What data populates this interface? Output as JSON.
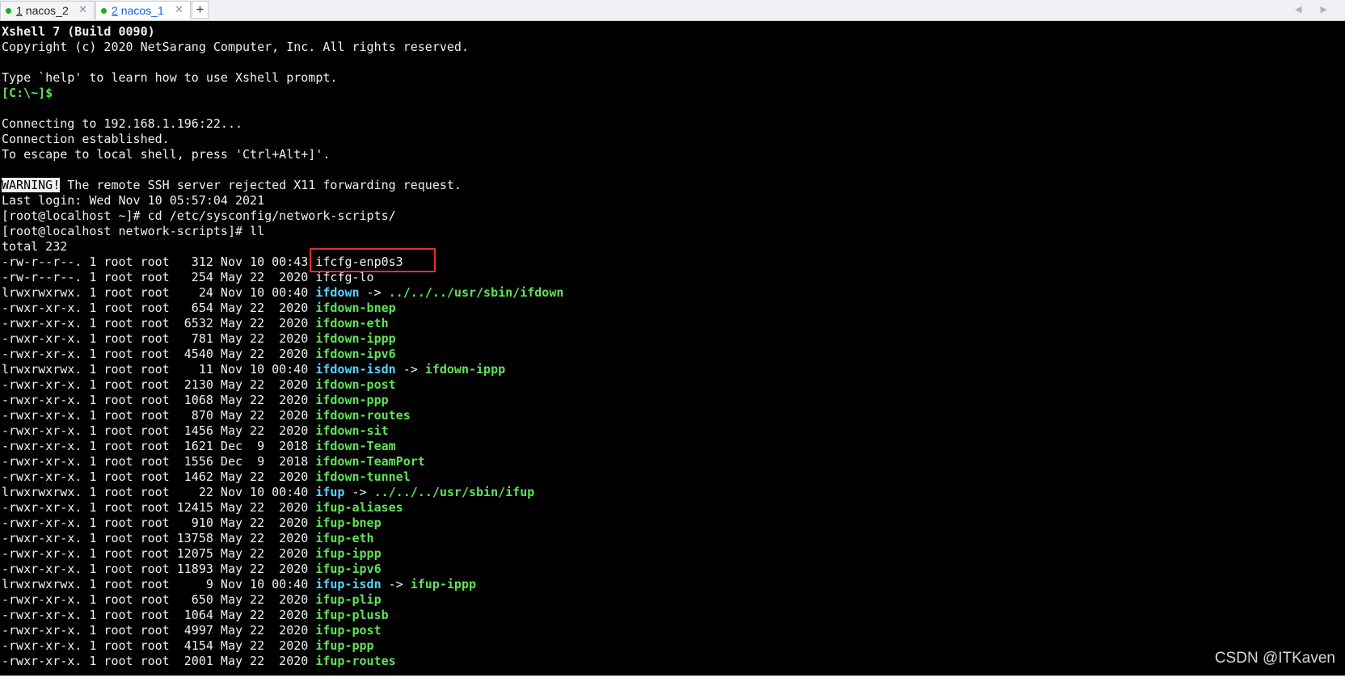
{
  "tabs": [
    {
      "num": "1",
      "name": "nacos_2",
      "active": false
    },
    {
      "num": "2",
      "name": "nacos_1",
      "active": true
    }
  ],
  "new_tab_label": "+",
  "nav_arrows": "◀ ▶",
  "colors": {
    "status_dot": "#18b018",
    "terminal_bg": "#000000",
    "executable": "#62e25a",
    "symlink": "#58d3ff",
    "prompt_green": "#62e25a",
    "highlight_box": "#e03030"
  },
  "terminal": {
    "lines": [
      [
        {
          "t": "Xshell 7 (Build 0090)",
          "s": "b"
        }
      ],
      [
        {
          "t": "Copyright (c) 2020 NetSarang Computer, Inc. All rights reserved."
        }
      ],
      [],
      [
        {
          "t": "Type `help' to learn how to use Xshell prompt."
        }
      ],
      [
        {
          "t": "[C:\\~]$ ",
          "s": "g"
        }
      ],
      [],
      [
        {
          "t": "Connecting to 192.168.1.196:22..."
        }
      ],
      [
        {
          "t": "Connection established."
        }
      ],
      [
        {
          "t": "To escape to local shell, press 'Ctrl+Alt+]'."
        }
      ],
      [],
      [
        {
          "t": "WARNING!",
          "s": "inv"
        },
        {
          "t": " The remote SSH server rejected X11 forwarding request."
        }
      ],
      [
        {
          "t": "Last login: Wed Nov 10 05:57:04 2021"
        }
      ],
      [
        {
          "t": "[root@localhost ~]# cd /etc/sysconfig/network-scripts/"
        }
      ],
      [
        {
          "t": "[root@localhost network-scripts]# ll"
        }
      ],
      [
        {
          "t": "total 232"
        }
      ],
      [
        {
          "t": "-rw-r--r--. 1 root root   312 Nov 10 00:43 "
        },
        {
          "t": "ifcfg-enp0s3",
          "s": "w"
        }
      ],
      [
        {
          "t": "-rw-r--r--. 1 root root   254 May 22  2020 "
        },
        {
          "t": "ifcfg-lo",
          "s": "w"
        }
      ],
      [
        {
          "t": "lrwxrwxrwx. 1 root root    24 Nov 10 00:40 "
        },
        {
          "t": "ifdown",
          "s": "c"
        },
        {
          "t": " -> "
        },
        {
          "t": "../../../usr/sbin/ifdown",
          "s": "g"
        }
      ],
      [
        {
          "t": "-rwxr-xr-x. 1 root root   654 May 22  2020 "
        },
        {
          "t": "ifdown-bnep",
          "s": "g"
        }
      ],
      [
        {
          "t": "-rwxr-xr-x. 1 root root  6532 May 22  2020 "
        },
        {
          "t": "ifdown-eth",
          "s": "g"
        }
      ],
      [
        {
          "t": "-rwxr-xr-x. 1 root root   781 May 22  2020 "
        },
        {
          "t": "ifdown-ippp",
          "s": "g"
        }
      ],
      [
        {
          "t": "-rwxr-xr-x. 1 root root  4540 May 22  2020 "
        },
        {
          "t": "ifdown-ipv6",
          "s": "g"
        }
      ],
      [
        {
          "t": "lrwxrwxrwx. 1 root root    11 Nov 10 00:40 "
        },
        {
          "t": "ifdown-isdn",
          "s": "c"
        },
        {
          "t": " -> "
        },
        {
          "t": "ifdown-ippp",
          "s": "g"
        }
      ],
      [
        {
          "t": "-rwxr-xr-x. 1 root root  2130 May 22  2020 "
        },
        {
          "t": "ifdown-post",
          "s": "g"
        }
      ],
      [
        {
          "t": "-rwxr-xr-x. 1 root root  1068 May 22  2020 "
        },
        {
          "t": "ifdown-ppp",
          "s": "g"
        }
      ],
      [
        {
          "t": "-rwxr-xr-x. 1 root root   870 May 22  2020 "
        },
        {
          "t": "ifdown-routes",
          "s": "g"
        }
      ],
      [
        {
          "t": "-rwxr-xr-x. 1 root root  1456 May 22  2020 "
        },
        {
          "t": "ifdown-sit",
          "s": "g"
        }
      ],
      [
        {
          "t": "-rwxr-xr-x. 1 root root  1621 Dec  9  2018 "
        },
        {
          "t": "ifdown-Team",
          "s": "g"
        }
      ],
      [
        {
          "t": "-rwxr-xr-x. 1 root root  1556 Dec  9  2018 "
        },
        {
          "t": "ifdown-TeamPort",
          "s": "g"
        }
      ],
      [
        {
          "t": "-rwxr-xr-x. 1 root root  1462 May 22  2020 "
        },
        {
          "t": "ifdown-tunnel",
          "s": "g"
        }
      ],
      [
        {
          "t": "lrwxrwxrwx. 1 root root    22 Nov 10 00:40 "
        },
        {
          "t": "ifup",
          "s": "c"
        },
        {
          "t": " -> "
        },
        {
          "t": "../../../usr/sbin/ifup",
          "s": "g"
        }
      ],
      [
        {
          "t": "-rwxr-xr-x. 1 root root 12415 May 22  2020 "
        },
        {
          "t": "ifup-aliases",
          "s": "g"
        }
      ],
      [
        {
          "t": "-rwxr-xr-x. 1 root root   910 May 22  2020 "
        },
        {
          "t": "ifup-bnep",
          "s": "g"
        }
      ],
      [
        {
          "t": "-rwxr-xr-x. 1 root root 13758 May 22  2020 "
        },
        {
          "t": "ifup-eth",
          "s": "g"
        }
      ],
      [
        {
          "t": "-rwxr-xr-x. 1 root root 12075 May 22  2020 "
        },
        {
          "t": "ifup-ippp",
          "s": "g"
        }
      ],
      [
        {
          "t": "-rwxr-xr-x. 1 root root 11893 May 22  2020 "
        },
        {
          "t": "ifup-ipv6",
          "s": "g"
        }
      ],
      [
        {
          "t": "lrwxrwxrwx. 1 root root     9 Nov 10 00:40 "
        },
        {
          "t": "ifup-isdn",
          "s": "c"
        },
        {
          "t": " -> "
        },
        {
          "t": "ifup-ippp",
          "s": "g"
        }
      ],
      [
        {
          "t": "-rwxr-xr-x. 1 root root   650 May 22  2020 "
        },
        {
          "t": "ifup-plip",
          "s": "g"
        }
      ],
      [
        {
          "t": "-rwxr-xr-x. 1 root root  1064 May 22  2020 "
        },
        {
          "t": "ifup-plusb",
          "s": "g"
        }
      ],
      [
        {
          "t": "-rwxr-xr-x. 1 root root  4997 May 22  2020 "
        },
        {
          "t": "ifup-post",
          "s": "g"
        }
      ],
      [
        {
          "t": "-rwxr-xr-x. 1 root root  4154 May 22  2020 "
        },
        {
          "t": "ifup-ppp",
          "s": "g"
        }
      ],
      [
        {
          "t": "-rwxr-xr-x. 1 root root  2001 May 22  2020 "
        },
        {
          "t": "ifup-routes",
          "s": "g"
        }
      ]
    ]
  },
  "watermark": "CSDN @ITKaven"
}
